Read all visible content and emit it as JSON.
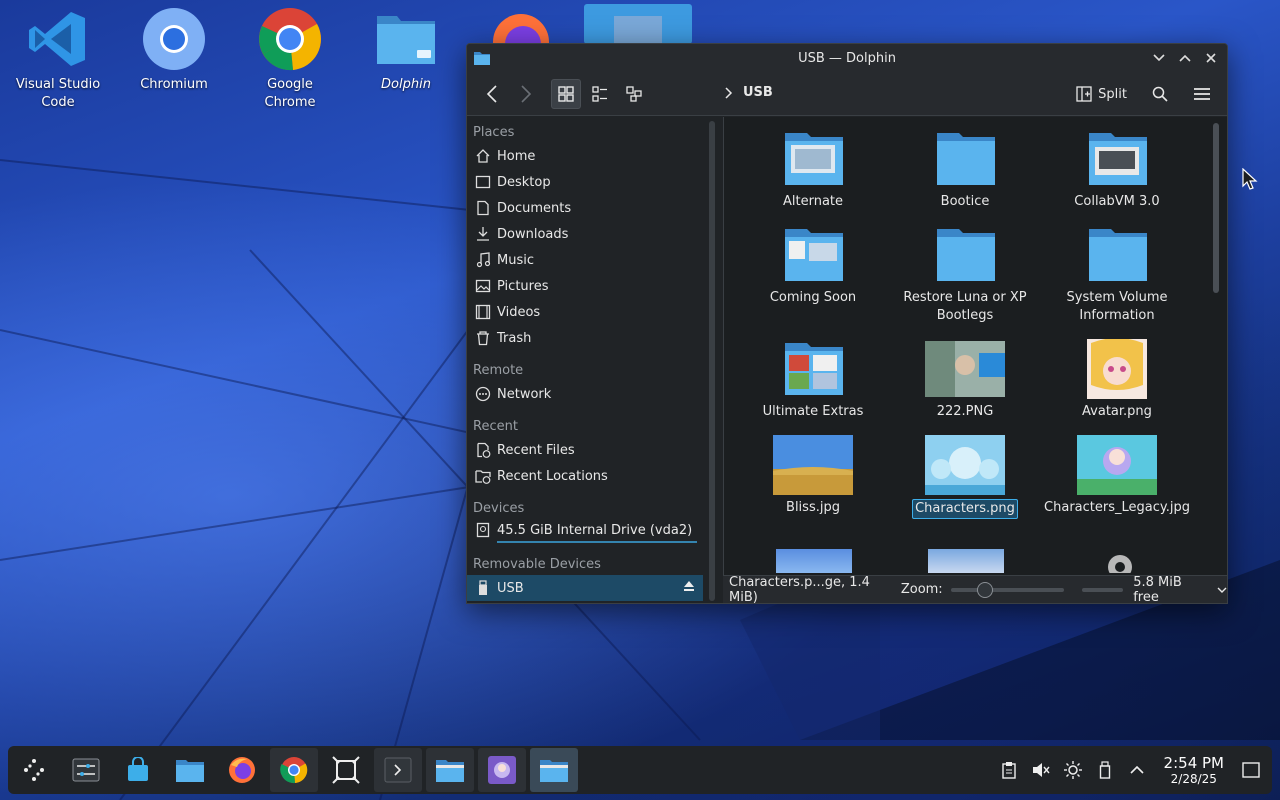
{
  "desktop": {
    "icons": [
      {
        "label": "Visual Studio Code",
        "icon": "vscode-icon"
      },
      {
        "label": "Chromium",
        "icon": "chromium-icon"
      },
      {
        "label": "Google Chrome",
        "icon": "chrome-icon"
      },
      {
        "label": "Dolphin",
        "icon": "folder-icon"
      }
    ]
  },
  "window": {
    "title": "USB — Dolphin",
    "breadcrumb": "USB",
    "split_label": "Split",
    "sidebar": {
      "places_header": "Places",
      "places": [
        "Home",
        "Desktop",
        "Documents",
        "Downloads",
        "Music",
        "Pictures",
        "Videos",
        "Trash"
      ],
      "remote_header": "Remote",
      "remote": [
        "Network"
      ],
      "recent_header": "Recent",
      "recent": [
        "Recent Files",
        "Recent Locations"
      ],
      "devices_header": "Devices",
      "devices": [
        "45.5 GiB Internal Drive (vda2)"
      ],
      "removable_header": "Removable Devices",
      "removable": [
        "USB"
      ]
    },
    "files": [
      {
        "name": "Alternate",
        "kind": "folder"
      },
      {
        "name": "Bootice",
        "kind": "folder"
      },
      {
        "name": "CollabVM 3.0",
        "kind": "folder"
      },
      {
        "name": "Coming Soon",
        "kind": "folder"
      },
      {
        "name": "Restore Luna or XP Bootlegs",
        "kind": "folder"
      },
      {
        "name": "System Volume Information",
        "kind": "folder"
      },
      {
        "name": "Ultimate Extras",
        "kind": "folder"
      },
      {
        "name": "222.PNG",
        "kind": "image"
      },
      {
        "name": "Avatar.png",
        "kind": "image"
      },
      {
        "name": "Bliss.jpg",
        "kind": "image"
      },
      {
        "name": "Characters.png",
        "kind": "image",
        "selected": true
      },
      {
        "name": "Characters_Legacy.jpg",
        "kind": "image"
      }
    ],
    "status": {
      "selection": "Characters.p...ge, 1.4 MiB)",
      "zoom_label": "Zoom:",
      "free": "5.8 MiB free"
    }
  },
  "taskbar": {
    "time": "2:54 PM",
    "date": "2/28/25"
  },
  "colors": {
    "accent": "#3daee9",
    "folder": "#4aa8e8",
    "selection": "#1d4a66"
  }
}
